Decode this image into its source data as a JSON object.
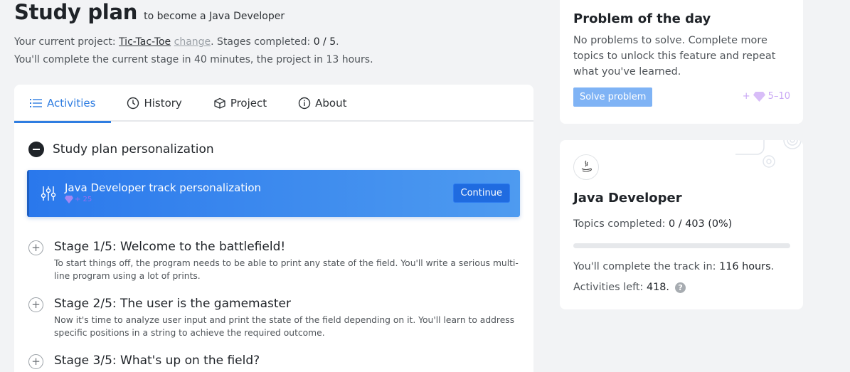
{
  "header": {
    "title": "Study plan",
    "subtitle": "to become a Java Developer",
    "project_prefix": "Your current project: ",
    "project_name": "Tic-Tac-Toe",
    "change_label": "change",
    "stages_prefix": ". Stages completed: ",
    "stages_value": "0 / 5",
    "stages_suffix": ".",
    "time_line": "You'll complete the current stage in 40 minutes, the project in 13 hours."
  },
  "tabs": [
    {
      "label": "Activities",
      "icon": "list-icon",
      "active": true
    },
    {
      "label": "History",
      "icon": "clock-icon",
      "active": false
    },
    {
      "label": "Project",
      "icon": "box-icon",
      "active": false
    },
    {
      "label": "About",
      "icon": "info-icon",
      "active": false
    }
  ],
  "personalization": {
    "section_title": "Study plan personalization",
    "item_title": "Java Developer track personalization",
    "item_reward": "+ 25",
    "continue_label": "Continue"
  },
  "stages": [
    {
      "title": "Stage 1/5: Welcome to the battlefield!",
      "description": "To start things off, the program needs to be able to print any state of the field. You'll write a serious multi-line program using a lot of prints."
    },
    {
      "title": "Stage 2/5: The user is the gamemaster",
      "description": "Now it's time to analyze user input and print the state of the field depending on it. You'll learn to address specific positions in a string to achieve the required outcome."
    },
    {
      "title": "Stage 3/5: What's up on the field?",
      "description": ""
    }
  ],
  "problem_of_day": {
    "title": "Problem of the day",
    "description": "No problems to solve. Complete more topics to unlock this feature and repeat what you've learned.",
    "button_label": "Solve problem",
    "reward_prefix": "+",
    "reward_range": "5–10"
  },
  "track": {
    "title": "Java Developer",
    "topics_label": "Topics completed: ",
    "topics_value": "0 / 403 (0%)",
    "progress_fraction": 0,
    "remain_label": "You'll complete the track in: ",
    "remain_value": "116 hours",
    "remain_suffix": ".",
    "activities_label": "Activities left: ",
    "activities_value": "418.",
    "help_glyph": "?"
  },
  "colors": {
    "accent": "#2f7de1",
    "banner": "#2a78ec",
    "gem": "#b98af5"
  }
}
